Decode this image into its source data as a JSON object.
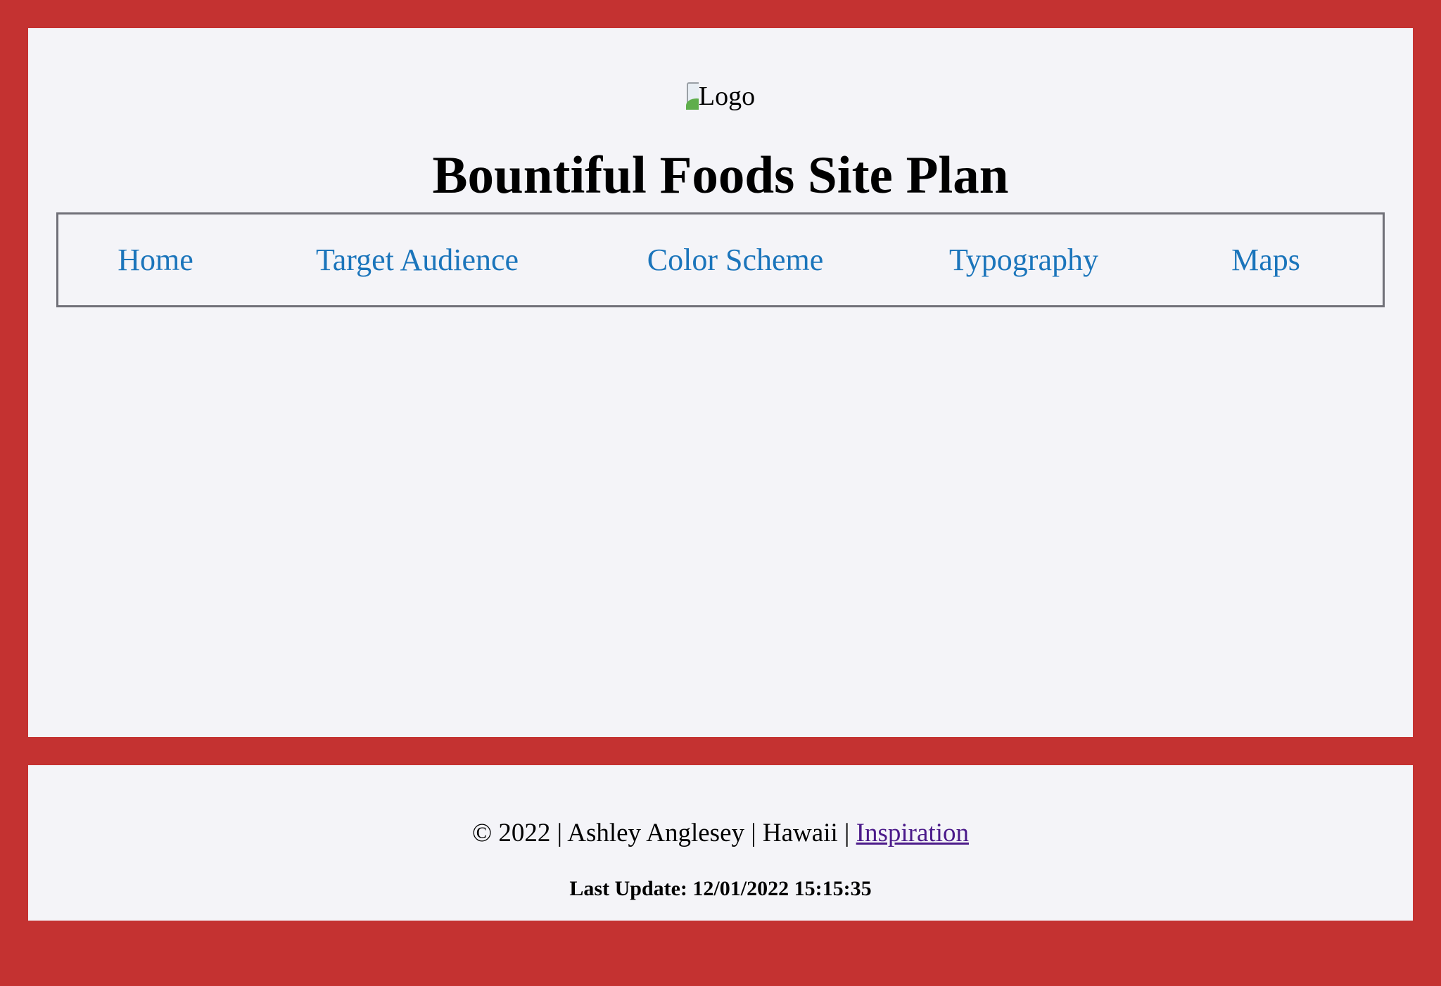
{
  "colors": {
    "page_background": "#c43231",
    "panel_background": "#f4f4f8",
    "nav_link": "#1b75bb",
    "visited_link": "#4b1a8a",
    "nav_border": "#707078"
  },
  "header": {
    "logo_alt": "Logo",
    "logo_icon": "broken-image-icon",
    "title": "Bountiful Foods Site Plan"
  },
  "nav": {
    "items": [
      {
        "label": "Home"
      },
      {
        "label": "Target Audience"
      },
      {
        "label": "Color Scheme"
      },
      {
        "label": "Typography"
      },
      {
        "label": "Maps"
      }
    ]
  },
  "footer": {
    "copyright": "© 2022 | Ashley Anglesey | Hawaii | ",
    "link_label": "Inspiration",
    "last_update": "Last Update: 12/01/2022 15:15:35"
  }
}
